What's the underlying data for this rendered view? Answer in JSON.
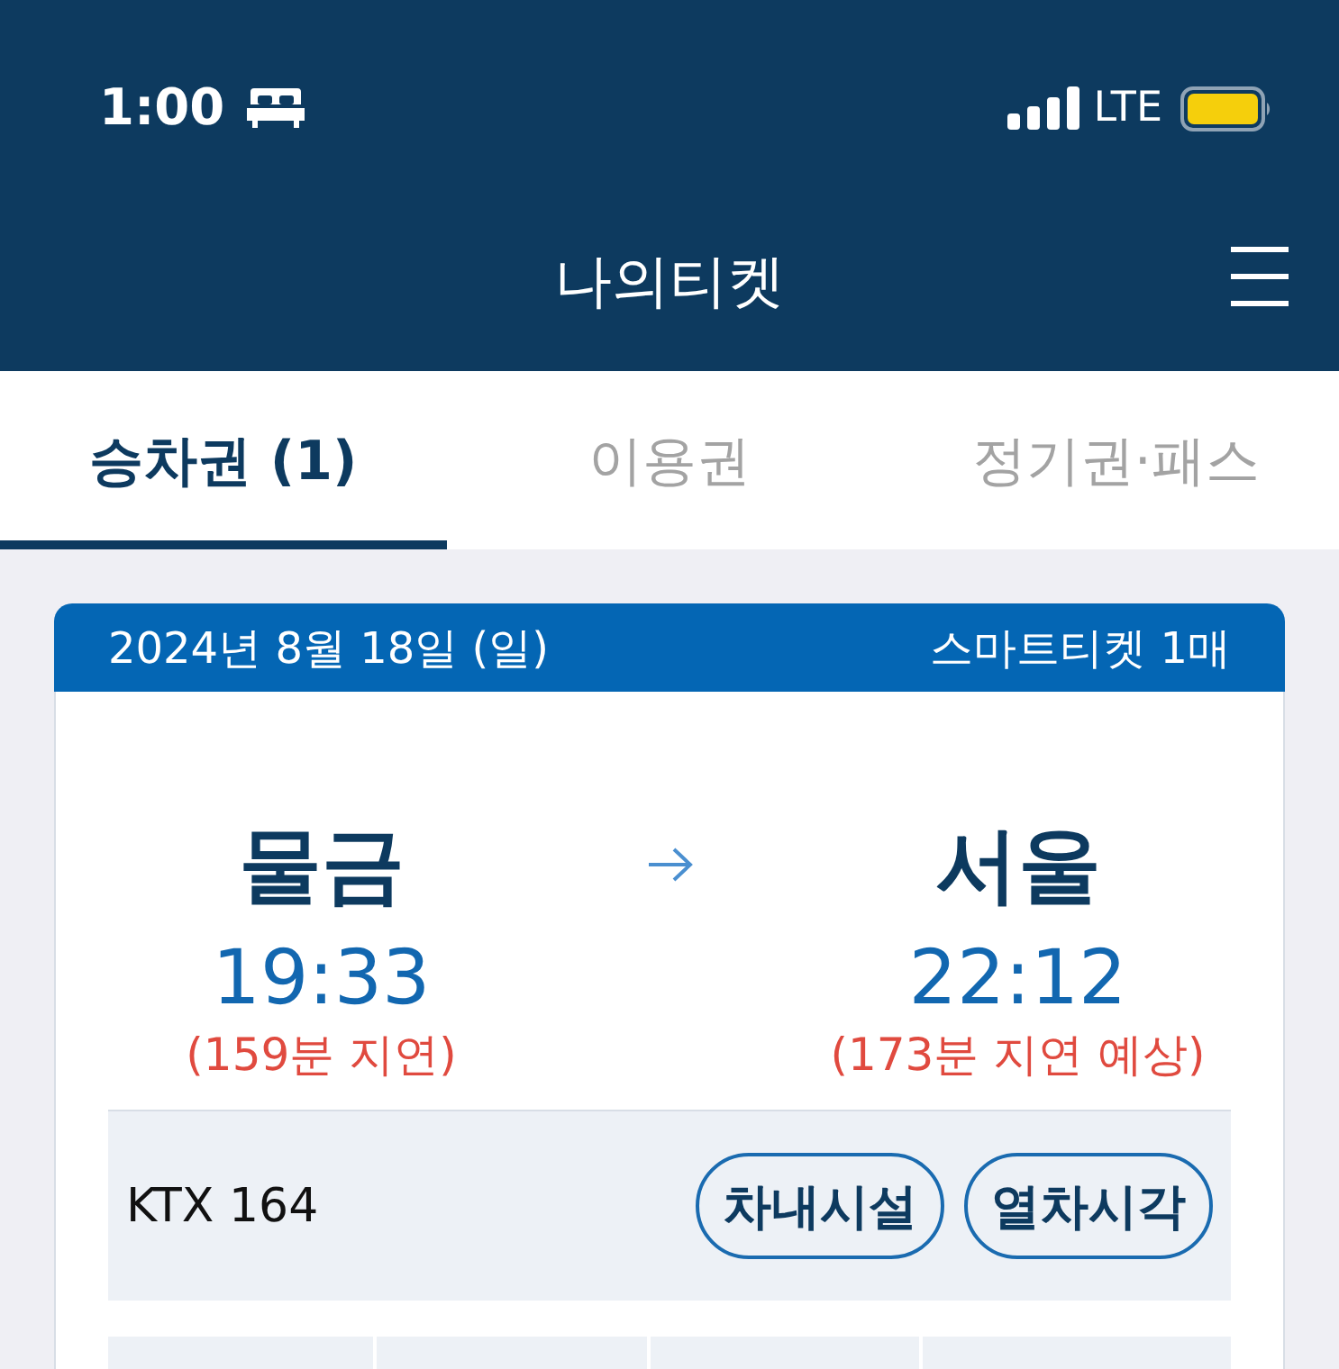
{
  "status_bar": {
    "time": "1:00",
    "network": "LTE"
  },
  "header": {
    "title": "나의티켓"
  },
  "tabs": [
    {
      "label": "승차권 (1)",
      "selected": true
    },
    {
      "label": "이용권",
      "selected": false
    },
    {
      "label": "정기권·패스",
      "selected": false
    }
  ],
  "ticket": {
    "date": "2024년 8월 18일 (일)",
    "ticket_count": "스마트티켓 1매",
    "departure": {
      "station": "물금",
      "time": "19:33",
      "delay": "(159분 지연)"
    },
    "arrival": {
      "station": "서울",
      "time": "22:12",
      "delay": "(173분 지연 예상)"
    },
    "train": "KTX 164",
    "buttons": [
      "차내시설",
      "열차시각"
    ]
  }
}
